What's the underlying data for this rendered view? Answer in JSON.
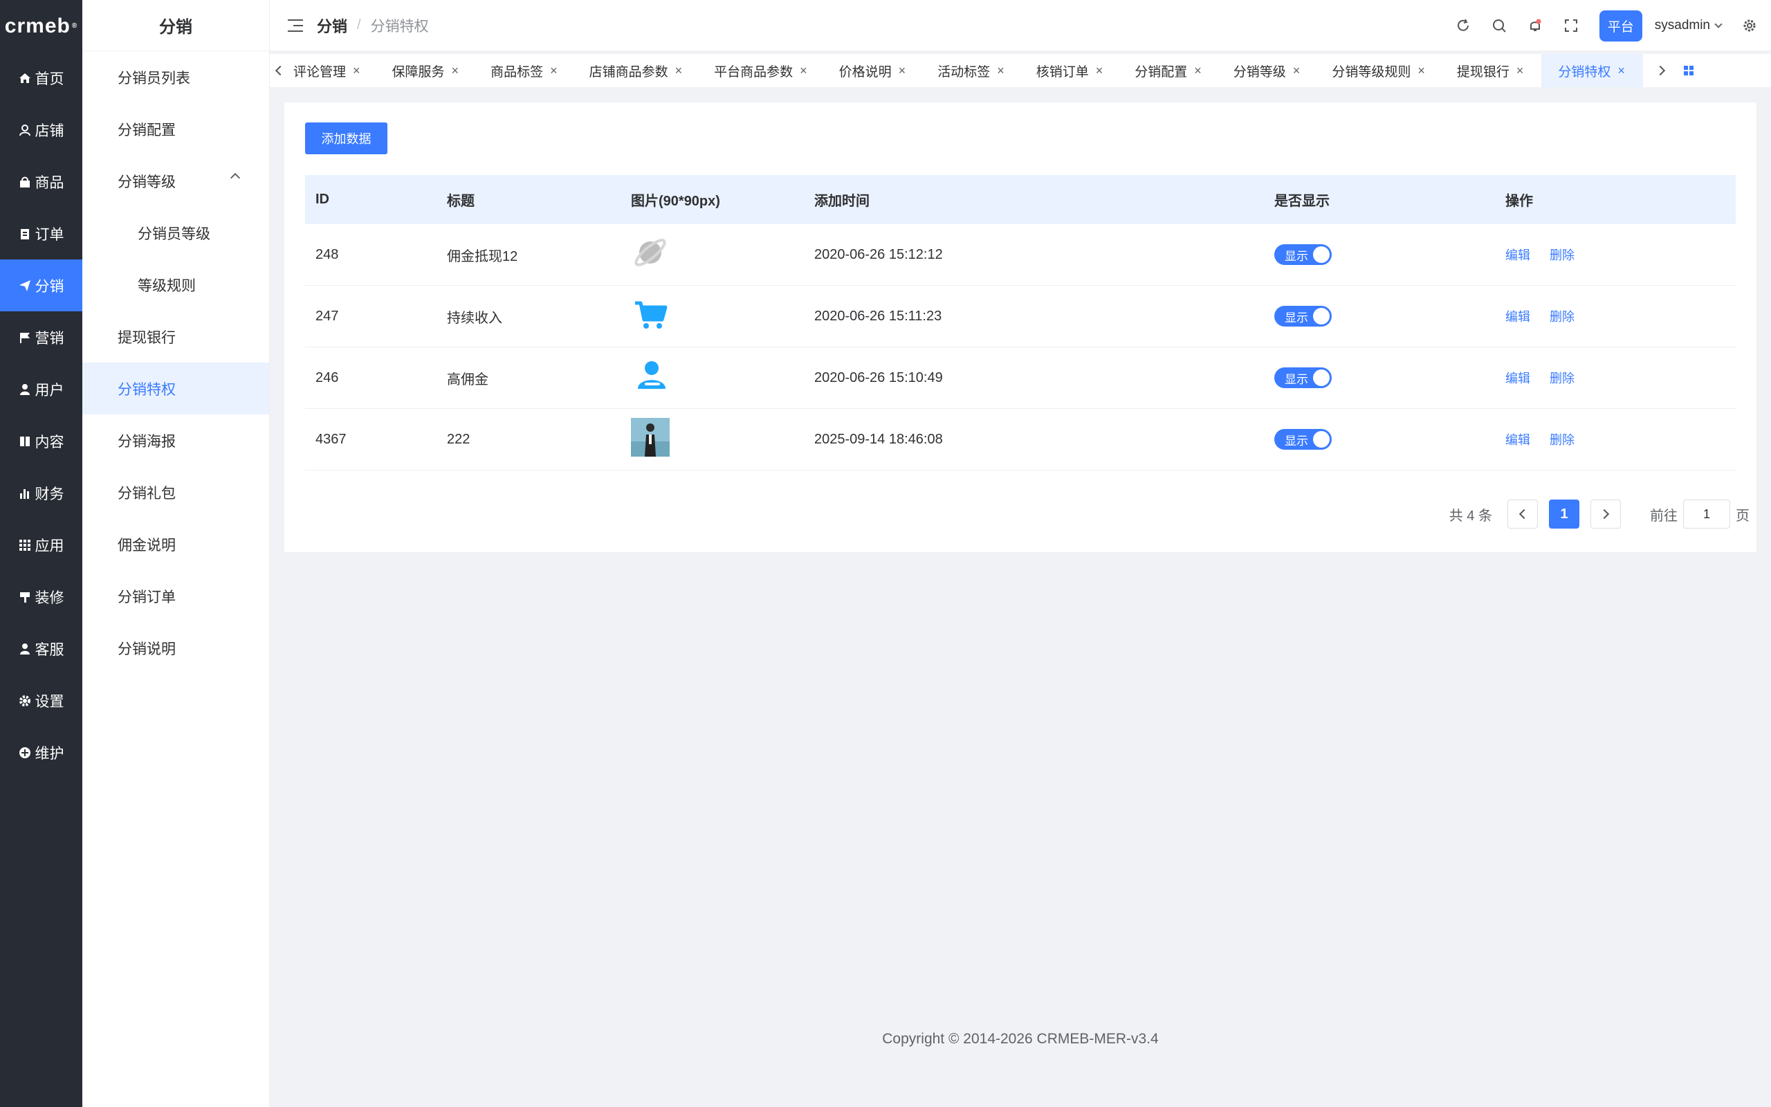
{
  "rail": {
    "logo": "crmeb",
    "logo_mark": "®",
    "items": [
      {
        "label": "首页",
        "icon": "home-icon"
      },
      {
        "label": "店铺",
        "icon": "store-user-icon"
      },
      {
        "label": "商品",
        "icon": "bag-icon"
      },
      {
        "label": "订单",
        "icon": "clipboard-icon"
      },
      {
        "label": "分销",
        "icon": "send-icon"
      },
      {
        "label": "营销",
        "icon": "flag-icon"
      },
      {
        "label": "用户",
        "icon": "user-icon"
      },
      {
        "label": "内容",
        "icon": "book-icon"
      },
      {
        "label": "财务",
        "icon": "bar-chart-icon"
      },
      {
        "label": "应用",
        "icon": "grid-icon"
      },
      {
        "label": "装修",
        "icon": "brush-icon"
      },
      {
        "label": "客服",
        "icon": "headset-icon"
      },
      {
        "label": "设置",
        "icon": "gear-icon"
      },
      {
        "label": "维护",
        "icon": "plus-circle-icon"
      }
    ]
  },
  "submenu": {
    "title": "分销",
    "items": [
      {
        "label": "分销员列表"
      },
      {
        "label": "分销配置"
      },
      {
        "label": "分销等级"
      },
      {
        "label": "分销员等级"
      },
      {
        "label": "等级规则"
      },
      {
        "label": "提现银行"
      },
      {
        "label": "分销特权"
      },
      {
        "label": "分销海报"
      },
      {
        "label": "分销礼包"
      },
      {
        "label": "佣金说明"
      },
      {
        "label": "分销订单"
      },
      {
        "label": "分销说明"
      }
    ]
  },
  "header": {
    "breadcrumb_parent": "分销",
    "breadcrumb_sep": "/",
    "breadcrumb_current": "分销特权",
    "platform": "平台",
    "username": "sysadmin"
  },
  "tabs": [
    {
      "label": "评论管理"
    },
    {
      "label": "保障服务"
    },
    {
      "label": "商品标签"
    },
    {
      "label": "店铺商品参数"
    },
    {
      "label": "平台商品参数"
    },
    {
      "label": "价格说明"
    },
    {
      "label": "活动标签"
    },
    {
      "label": "核销订单"
    },
    {
      "label": "分销配置"
    },
    {
      "label": "分销等级"
    },
    {
      "label": "分销等级规则"
    },
    {
      "label": "提现银行"
    },
    {
      "label": "分销特权"
    }
  ],
  "tab_close": "×",
  "main": {
    "add_button": "添加数据",
    "columns": [
      "ID",
      "标题",
      "图片(90*90px)",
      "添加时间",
      "是否显示",
      "操作"
    ],
    "rows": [
      {
        "id": "248",
        "title": "佣金抵现12",
        "img": "planet-icon",
        "time": "2020-06-26 15:12:12",
        "show": "显示"
      },
      {
        "id": "247",
        "title": "持续收入",
        "img": "cart-icon",
        "time": "2020-06-26 15:11:23",
        "show": "显示"
      },
      {
        "id": "246",
        "title": "高佣金",
        "img": "person-icon",
        "time": "2020-06-26 15:10:49",
        "show": "显示"
      },
      {
        "id": "4367",
        "title": "222",
        "img": "photo-thumbnail",
        "time": "2025-09-14 18:46:08",
        "show": "显示"
      }
    ],
    "edit_label": "编辑",
    "delete_label": "删除"
  },
  "pager": {
    "total": "共 4 条",
    "current": "1",
    "goto_label": "前往",
    "goto_value": "1",
    "page_suffix": "页"
  },
  "footer": "Copyright © 2014-2026 CRMEB-MER-v3.4",
  "colors": {
    "accent": "#3a7bff",
    "rail_bg": "#282c34",
    "light_accent": "#eaf2ff"
  }
}
